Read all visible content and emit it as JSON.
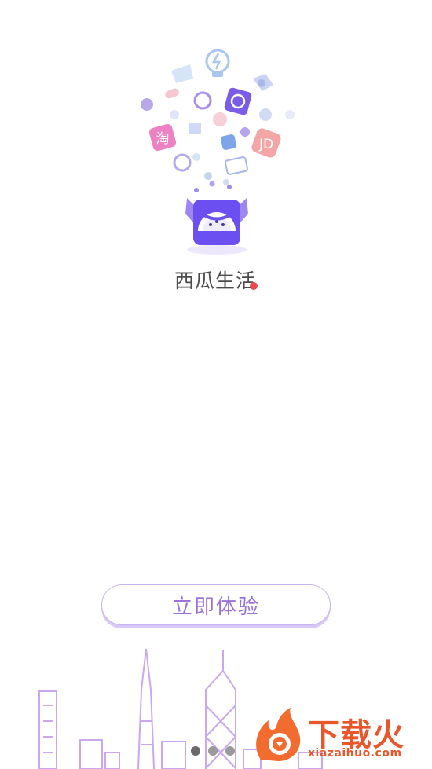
{
  "app": {
    "name": "西瓜生活"
  },
  "cta": {
    "label": "立即体验"
  },
  "pager": {
    "count": 3,
    "active_index": 0
  },
  "watermark": {
    "title": "下载火",
    "url": "xiazaihuo.com"
  },
  "colors": {
    "accent": "#9a72d8",
    "logo_box": "#6c4ff0",
    "watermark": "#e8572b"
  },
  "icons": [
    "lightbulb-icon",
    "shopping-basket-icon",
    "bird-icon",
    "taobao-icon",
    "music-icon",
    "jd-icon",
    "camera-icon",
    "bubble-icon",
    "gift-icon",
    "miniy-icon",
    "watermelon-logo-icon"
  ]
}
